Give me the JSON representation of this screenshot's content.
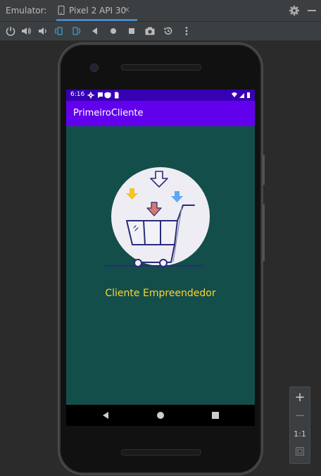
{
  "header": {
    "label": "Emulator:",
    "tab_title": "Pixel 2 API 30",
    "tab_close": "✕"
  },
  "toolbar": {
    "icons": [
      "power-icon",
      "volume-up-icon",
      "volume-down-icon",
      "rotate-left-icon",
      "rotate-right-icon",
      "back-icon",
      "home-icon",
      "overview-icon",
      "camera-icon",
      "snapshot-icon",
      "more-icon"
    ]
  },
  "device": {
    "status": {
      "time": "6:16"
    },
    "app_title": "PrimeiroCliente",
    "caption": "Cliente Empreendedor"
  },
  "zoom": {
    "plus": "+",
    "minus": "−",
    "ratio": "1:1"
  },
  "colors": {
    "accent_tab": "#4a88c7",
    "status_bar": "#3700b3",
    "app_bar": "#6200ee",
    "screen_bg": "#134e4a",
    "caption": "#fcd535"
  }
}
